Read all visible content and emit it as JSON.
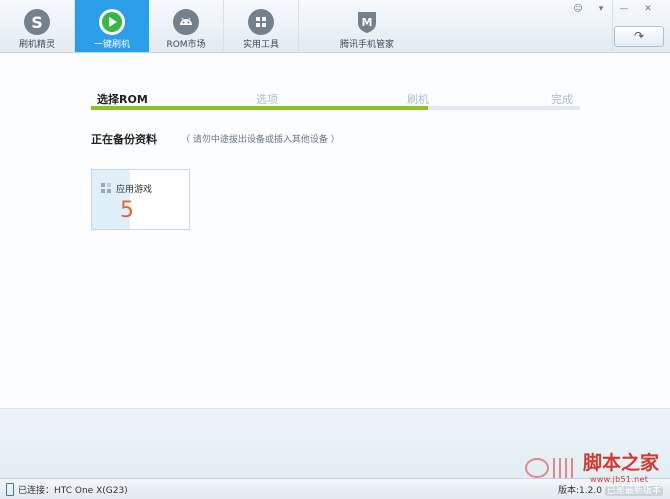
{
  "toolbar": {
    "tabs": [
      {
        "label": "刷机精灵",
        "icon": "s-logo-icon"
      },
      {
        "label": "一键刷机",
        "icon": "play-icon",
        "active": true
      },
      {
        "label": "ROM市场",
        "icon": "android-icon"
      },
      {
        "label": "实用工具",
        "icon": "grid-tools-icon"
      },
      {
        "label": "腾讯手机管家",
        "icon": "shield-m-icon"
      }
    ],
    "window_controls": [
      "☺",
      "▾",
      "—",
      "✕"
    ],
    "back_label": "↷"
  },
  "steps": {
    "labels": [
      "选择ROM",
      "选项",
      "刷机",
      "完成"
    ],
    "current": 0,
    "progress": 0.69
  },
  "main": {
    "title": "正在备份资料",
    "hint": "（ 请勿中途拔出设备或插入其他设备 ）",
    "card": {
      "label": "应用游戏",
      "count": "5"
    }
  },
  "status": {
    "connection": "已连接：HTC One X(G23)",
    "version": "版本:1.2.0",
    "version_badge": "已是最新版本"
  },
  "watermark": {
    "site": "脚本之家",
    "url": "www.jb51.net"
  },
  "colors": {
    "accent": "#2a9ee8",
    "progress": "#8dc21f",
    "count": "#e06a2c"
  }
}
